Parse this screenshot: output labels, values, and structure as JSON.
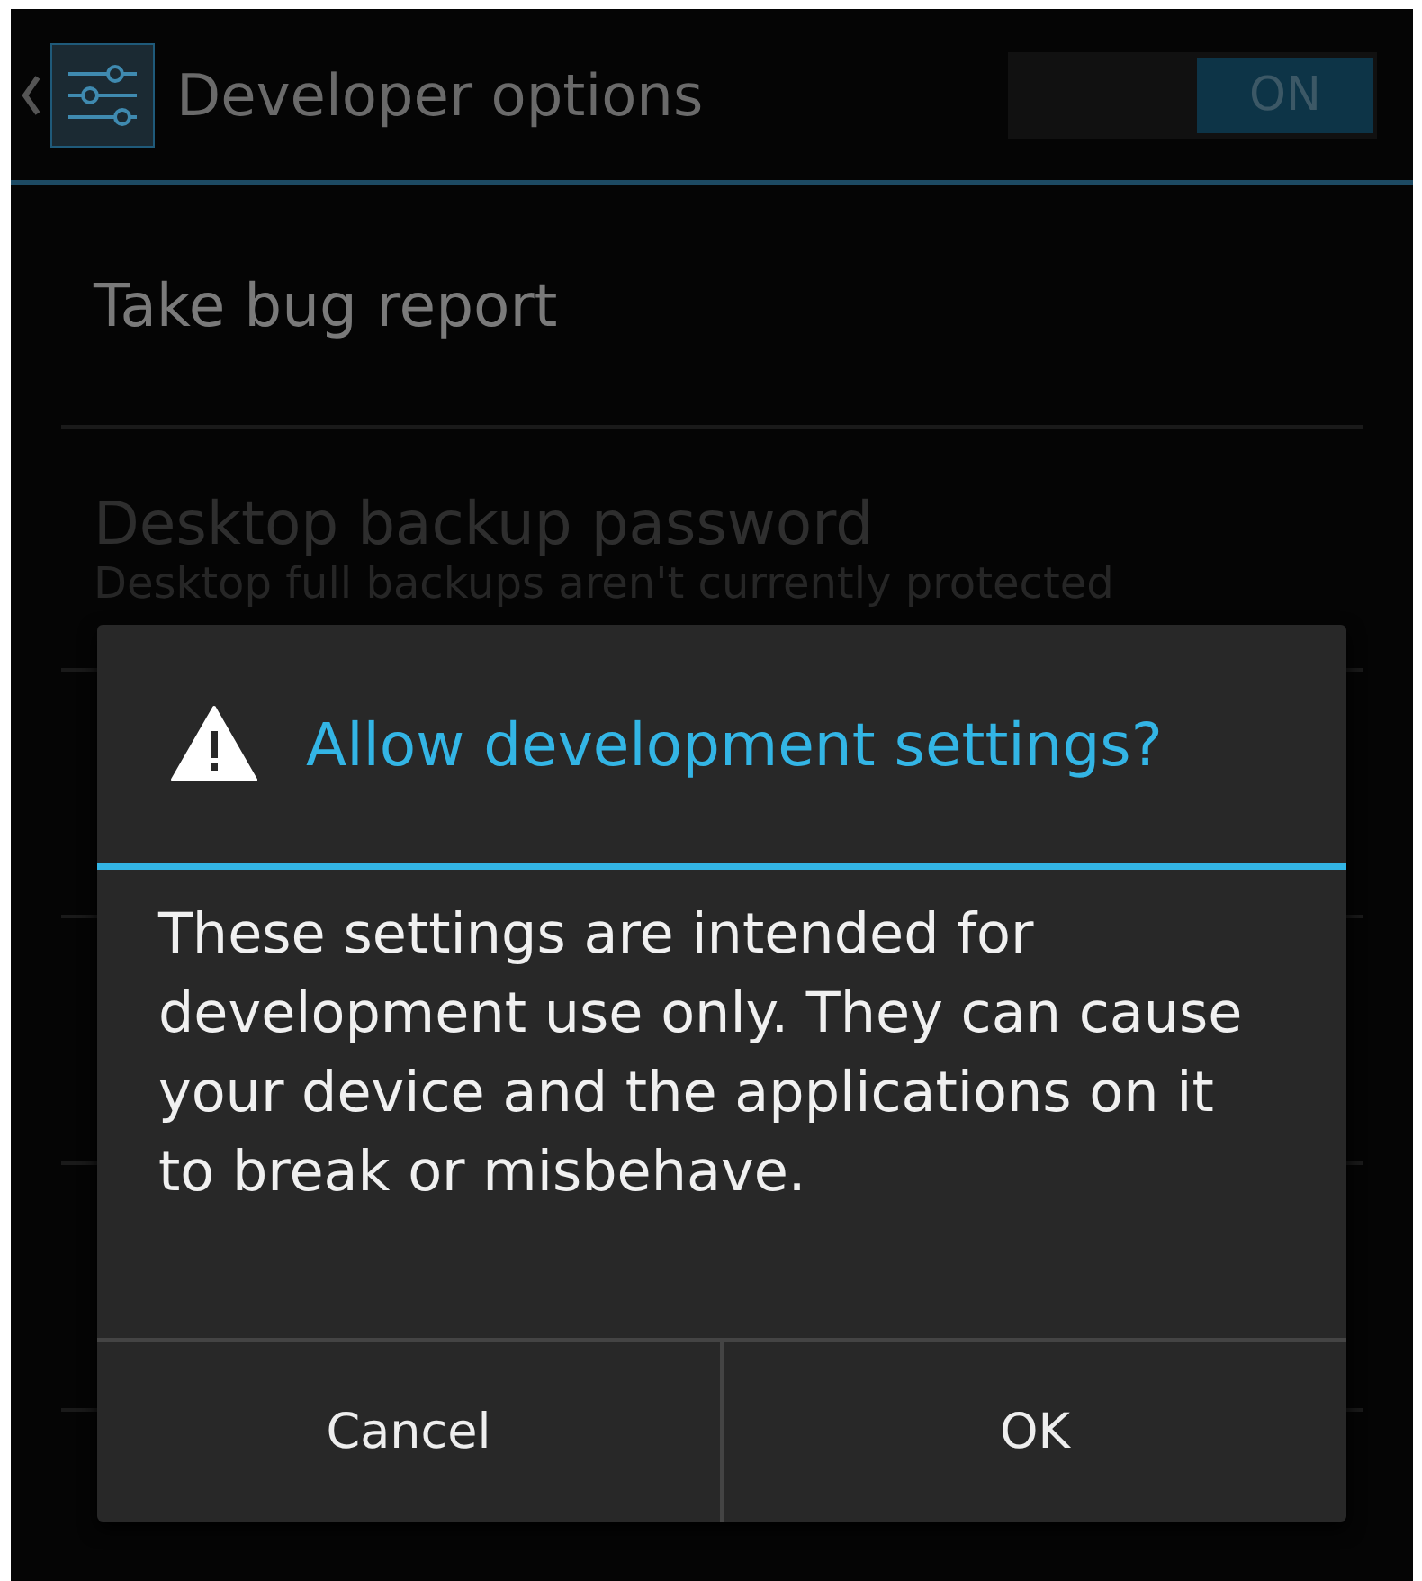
{
  "action_bar": {
    "title": "Developer options",
    "switch": {
      "label": "ON",
      "on": true
    }
  },
  "settings": [
    {
      "title": "Take bug report",
      "disabled": false
    },
    {
      "title": "Desktop backup password",
      "summary": "Desktop full backups aren't currently protected",
      "disabled": true
    }
  ],
  "dialog": {
    "title": "Allow development settings?",
    "message": "These settings are intended for development use only. They can cause your device and the applications on it to break or misbehave.",
    "buttons": [
      "Cancel",
      "OK"
    ]
  }
}
